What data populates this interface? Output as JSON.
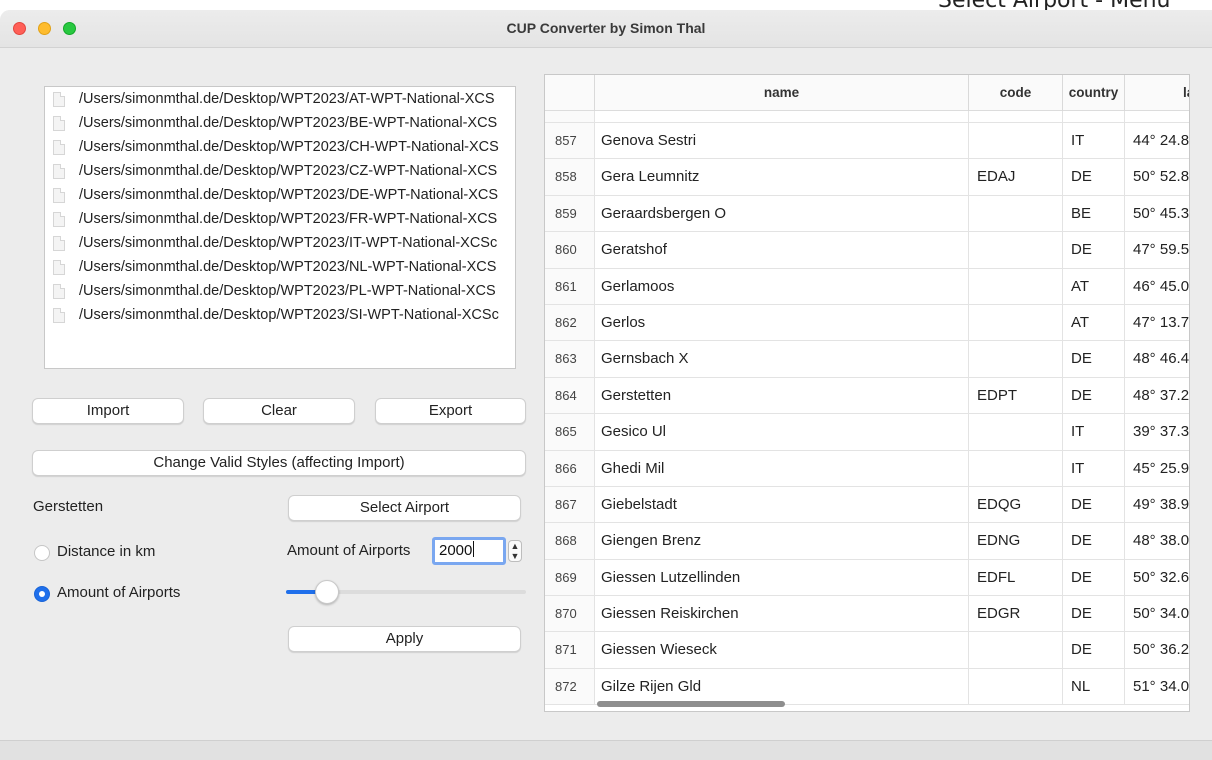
{
  "caption": "Select Airport - Menu",
  "window": {
    "title": "CUP Converter by Simon Thal"
  },
  "files": [
    "/Users/simonmthal.de/Desktop/WPT2023/AT-WPT-National-XCS",
    "/Users/simonmthal.de/Desktop/WPT2023/BE-WPT-National-XCS",
    "/Users/simonmthal.de/Desktop/WPT2023/CH-WPT-National-XCS",
    "/Users/simonmthal.de/Desktop/WPT2023/CZ-WPT-National-XCS",
    "/Users/simonmthal.de/Desktop/WPT2023/DE-WPT-National-XCS",
    "/Users/simonmthal.de/Desktop/WPT2023/FR-WPT-National-XCS",
    "/Users/simonmthal.de/Desktop/WPT2023/IT-WPT-National-XCSc",
    "/Users/simonmthal.de/Desktop/WPT2023/NL-WPT-National-XCS",
    "/Users/simonmthal.de/Desktop/WPT2023/PL-WPT-National-XCS",
    "/Users/simonmthal.de/Desktop/WPT2023/SI-WPT-National-XCSc"
  ],
  "buttons": {
    "import": "Import",
    "clear": "Clear",
    "export": "Export",
    "change_styles": "Change Valid Styles (affecting Import)",
    "select_airport": "Select Airport",
    "apply": "Apply"
  },
  "selected_airport": "Gerstetten",
  "options": {
    "distance_label": "Distance in km",
    "amount_label": "Amount of Airports",
    "selected": "amount"
  },
  "amount": {
    "label": "Amount of Airports",
    "value": "2000",
    "slider_fraction": 0.18
  },
  "table": {
    "columns": [
      "name",
      "code",
      "country",
      "la"
    ],
    "rows": [
      {
        "index": "857",
        "name": "Genova Sestri",
        "code": "",
        "country": "IT",
        "lat": "44° 24.8"
      },
      {
        "index": "858",
        "name": "Gera Leumnitz",
        "code": "EDAJ",
        "country": "DE",
        "lat": "50° 52.8"
      },
      {
        "index": "859",
        "name": "Geraardsbergen O",
        "code": "",
        "country": "BE",
        "lat": "50° 45.3"
      },
      {
        "index": "860",
        "name": "Geratshof",
        "code": "",
        "country": "DE",
        "lat": "47° 59.5"
      },
      {
        "index": "861",
        "name": "Gerlamoos",
        "code": "",
        "country": "AT",
        "lat": "46° 45.0"
      },
      {
        "index": "862",
        "name": "Gerlos",
        "code": "",
        "country": "AT",
        "lat": "47° 13.7"
      },
      {
        "index": "863",
        "name": "Gernsbach X",
        "code": "",
        "country": "DE",
        "lat": "48° 46.4"
      },
      {
        "index": "864",
        "name": "Gerstetten",
        "code": "EDPT",
        "country": "DE",
        "lat": "48° 37.2"
      },
      {
        "index": "865",
        "name": "Gesico Ul",
        "code": "",
        "country": "IT",
        "lat": "39° 37.3"
      },
      {
        "index": "866",
        "name": "Ghedi Mil",
        "code": "",
        "country": "IT",
        "lat": "45° 25.9"
      },
      {
        "index": "867",
        "name": "Giebelstadt",
        "code": "EDQG",
        "country": "DE",
        "lat": "49° 38.9"
      },
      {
        "index": "868",
        "name": "Giengen Brenz",
        "code": "EDNG",
        "country": "DE",
        "lat": "48° 38.0"
      },
      {
        "index": "869",
        "name": "Giessen Lutzellinden",
        "code": "EDFL",
        "country": "DE",
        "lat": "50° 32.6"
      },
      {
        "index": "870",
        "name": "Giessen Reiskirchen",
        "code": "EDGR",
        "country": "DE",
        "lat": "50° 34.0"
      },
      {
        "index": "871",
        "name": "Giessen Wieseck",
        "code": "",
        "country": "DE",
        "lat": "50° 36.2"
      },
      {
        "index": "872",
        "name": "Gilze Rijen Gld",
        "code": "",
        "country": "NL",
        "lat": "51° 34.0"
      }
    ]
  },
  "icons": {
    "file": "file-icon",
    "spin": "stepper-arrows-icon"
  },
  "colors": {
    "accent": "#1f6feb",
    "close": "#ff5f57",
    "minimize": "#febc2e",
    "zoom": "#28c840"
  }
}
